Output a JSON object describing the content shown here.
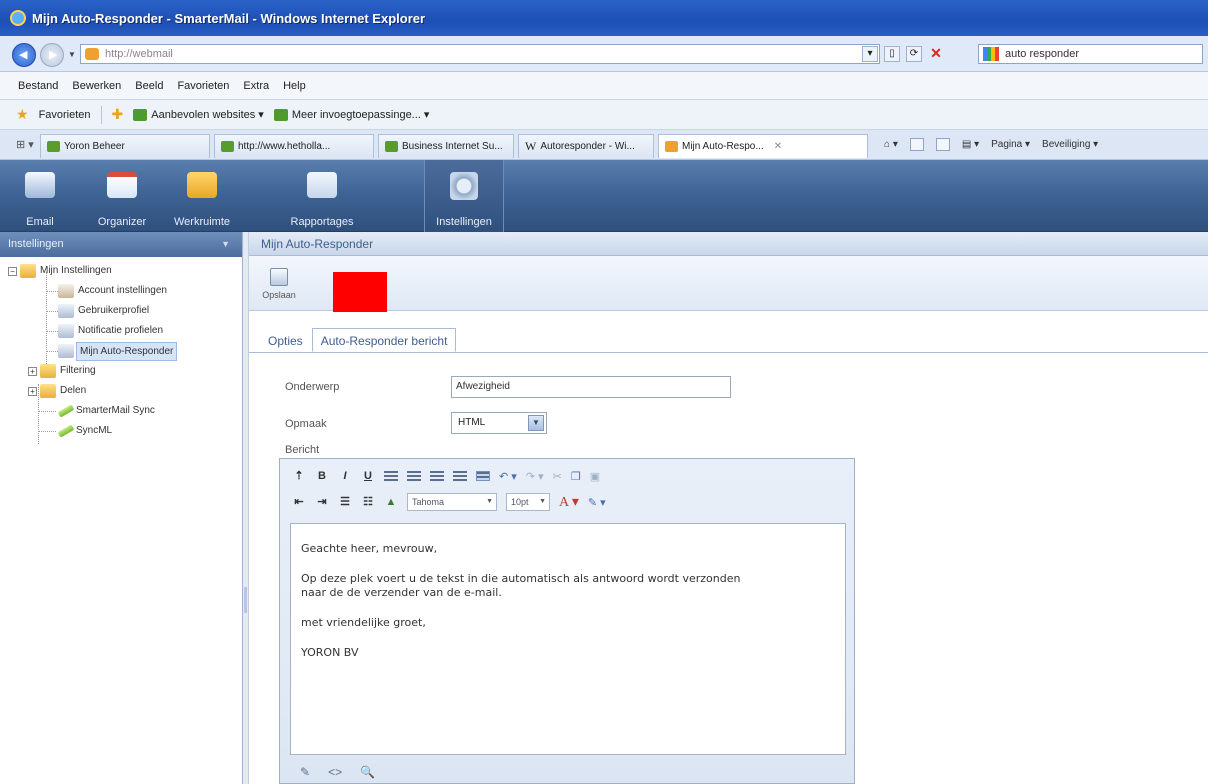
{
  "window": {
    "title": "Mijn Auto-Responder - SmarterMail - Windows Internet Explorer"
  },
  "address": {
    "url": "http://webmail",
    "search": "auto responder"
  },
  "menu": [
    "Bestand",
    "Bewerken",
    "Beeld",
    "Favorieten",
    "Extra",
    "Help"
  ],
  "favorites": {
    "label": "Favorieten",
    "items": [
      "Aanbevolen websites ▾",
      "Meer invoegtoepassinge... ▾"
    ]
  },
  "tabs": [
    {
      "label": "Yoron Beheer"
    },
    {
      "label": "http://www.hetholla..."
    },
    {
      "label": "Business Internet Su..."
    },
    {
      "label": "Autoresponder - Wi..."
    },
    {
      "label": "Mijn Auto-Respo..."
    }
  ],
  "ie_commands": {
    "pagina": "Pagina ▾",
    "beveiliging": "Beveiliging ▾"
  },
  "app_nav": [
    "Email",
    "Organizer",
    "Werkruimte",
    "Rapportages",
    "Instellingen"
  ],
  "sidebar": {
    "title": "Instellingen",
    "root": "Mijn Instellingen",
    "items": [
      "Account instellingen",
      "Gebruikerprofiel",
      "Notificatie profielen",
      "Mijn Auto-Responder",
      "Filtering",
      "Delen",
      "SmarterMail Sync",
      "SyncML"
    ]
  },
  "page": {
    "title": "Mijn Auto-Responder",
    "save_label": "Opslaan",
    "tabs": [
      "Opties",
      "Auto-Responder bericht"
    ]
  },
  "form": {
    "subject_label": "Onderwerp",
    "subject_value": "Afwezigheid",
    "format_label": "Opmaak",
    "format_value": "HTML",
    "message_label": "Bericht"
  },
  "editor": {
    "font": "Tahoma",
    "size": "10pt",
    "lines": {
      "greeting": "Geachte heer, mevrouw,",
      "body1": "Op deze plek voert u de tekst in die automatisch als antwoord wordt verzonden",
      "body2": "naar de de verzender van de e-mail.",
      "closing": "met vriendelijke groet,",
      "signature": "YORON BV"
    }
  },
  "colors": {
    "accent_red": "#ff0000",
    "header_blue": "#3f6496"
  }
}
